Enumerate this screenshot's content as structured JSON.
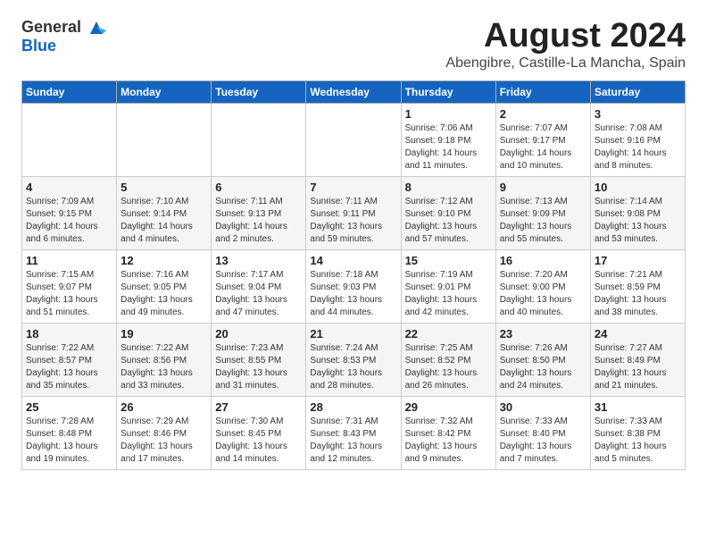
{
  "logo": {
    "line1": "General",
    "line2": "Blue"
  },
  "header": {
    "month": "August 2024",
    "location": "Abengibre, Castille-La Mancha, Spain"
  },
  "weekdays": [
    "Sunday",
    "Monday",
    "Tuesday",
    "Wednesday",
    "Thursday",
    "Friday",
    "Saturday"
  ],
  "weeks": [
    [
      {
        "day": "",
        "content": ""
      },
      {
        "day": "",
        "content": ""
      },
      {
        "day": "",
        "content": ""
      },
      {
        "day": "",
        "content": ""
      },
      {
        "day": "1",
        "content": "Sunrise: 7:06 AM\nSunset: 9:18 PM\nDaylight: 14 hours\nand 11 minutes."
      },
      {
        "day": "2",
        "content": "Sunrise: 7:07 AM\nSunset: 9:17 PM\nDaylight: 14 hours\nand 10 minutes."
      },
      {
        "day": "3",
        "content": "Sunrise: 7:08 AM\nSunset: 9:16 PM\nDaylight: 14 hours\nand 8 minutes."
      }
    ],
    [
      {
        "day": "4",
        "content": "Sunrise: 7:09 AM\nSunset: 9:15 PM\nDaylight: 14 hours\nand 6 minutes."
      },
      {
        "day": "5",
        "content": "Sunrise: 7:10 AM\nSunset: 9:14 PM\nDaylight: 14 hours\nand 4 minutes."
      },
      {
        "day": "6",
        "content": "Sunrise: 7:11 AM\nSunset: 9:13 PM\nDaylight: 14 hours\nand 2 minutes."
      },
      {
        "day": "7",
        "content": "Sunrise: 7:11 AM\nSunset: 9:11 PM\nDaylight: 13 hours\nand 59 minutes."
      },
      {
        "day": "8",
        "content": "Sunrise: 7:12 AM\nSunset: 9:10 PM\nDaylight: 13 hours\nand 57 minutes."
      },
      {
        "day": "9",
        "content": "Sunrise: 7:13 AM\nSunset: 9:09 PM\nDaylight: 13 hours\nand 55 minutes."
      },
      {
        "day": "10",
        "content": "Sunrise: 7:14 AM\nSunset: 9:08 PM\nDaylight: 13 hours\nand 53 minutes."
      }
    ],
    [
      {
        "day": "11",
        "content": "Sunrise: 7:15 AM\nSunset: 9:07 PM\nDaylight: 13 hours\nand 51 minutes."
      },
      {
        "day": "12",
        "content": "Sunrise: 7:16 AM\nSunset: 9:05 PM\nDaylight: 13 hours\nand 49 minutes."
      },
      {
        "day": "13",
        "content": "Sunrise: 7:17 AM\nSunset: 9:04 PM\nDaylight: 13 hours\nand 47 minutes."
      },
      {
        "day": "14",
        "content": "Sunrise: 7:18 AM\nSunset: 9:03 PM\nDaylight: 13 hours\nand 44 minutes."
      },
      {
        "day": "15",
        "content": "Sunrise: 7:19 AM\nSunset: 9:01 PM\nDaylight: 13 hours\nand 42 minutes."
      },
      {
        "day": "16",
        "content": "Sunrise: 7:20 AM\nSunset: 9:00 PM\nDaylight: 13 hours\nand 40 minutes."
      },
      {
        "day": "17",
        "content": "Sunrise: 7:21 AM\nSunset: 8:59 PM\nDaylight: 13 hours\nand 38 minutes."
      }
    ],
    [
      {
        "day": "18",
        "content": "Sunrise: 7:22 AM\nSunset: 8:57 PM\nDaylight: 13 hours\nand 35 minutes."
      },
      {
        "day": "19",
        "content": "Sunrise: 7:22 AM\nSunset: 8:56 PM\nDaylight: 13 hours\nand 33 minutes."
      },
      {
        "day": "20",
        "content": "Sunrise: 7:23 AM\nSunset: 8:55 PM\nDaylight: 13 hours\nand 31 minutes."
      },
      {
        "day": "21",
        "content": "Sunrise: 7:24 AM\nSunset: 8:53 PM\nDaylight: 13 hours\nand 28 minutes."
      },
      {
        "day": "22",
        "content": "Sunrise: 7:25 AM\nSunset: 8:52 PM\nDaylight: 13 hours\nand 26 minutes."
      },
      {
        "day": "23",
        "content": "Sunrise: 7:26 AM\nSunset: 8:50 PM\nDaylight: 13 hours\nand 24 minutes."
      },
      {
        "day": "24",
        "content": "Sunrise: 7:27 AM\nSunset: 8:49 PM\nDaylight: 13 hours\nand 21 minutes."
      }
    ],
    [
      {
        "day": "25",
        "content": "Sunrise: 7:28 AM\nSunset: 8:48 PM\nDaylight: 13 hours\nand 19 minutes."
      },
      {
        "day": "26",
        "content": "Sunrise: 7:29 AM\nSunset: 8:46 PM\nDaylight: 13 hours\nand 17 minutes."
      },
      {
        "day": "27",
        "content": "Sunrise: 7:30 AM\nSunset: 8:45 PM\nDaylight: 13 hours\nand 14 minutes."
      },
      {
        "day": "28",
        "content": "Sunrise: 7:31 AM\nSunset: 8:43 PM\nDaylight: 13 hours\nand 12 minutes."
      },
      {
        "day": "29",
        "content": "Sunrise: 7:32 AM\nSunset: 8:42 PM\nDaylight: 13 hours\nand 9 minutes."
      },
      {
        "day": "30",
        "content": "Sunrise: 7:33 AM\nSunset: 8:40 PM\nDaylight: 13 hours\nand 7 minutes."
      },
      {
        "day": "31",
        "content": "Sunrise: 7:33 AM\nSunset: 8:38 PM\nDaylight: 13 hours\nand 5 minutes."
      }
    ]
  ]
}
